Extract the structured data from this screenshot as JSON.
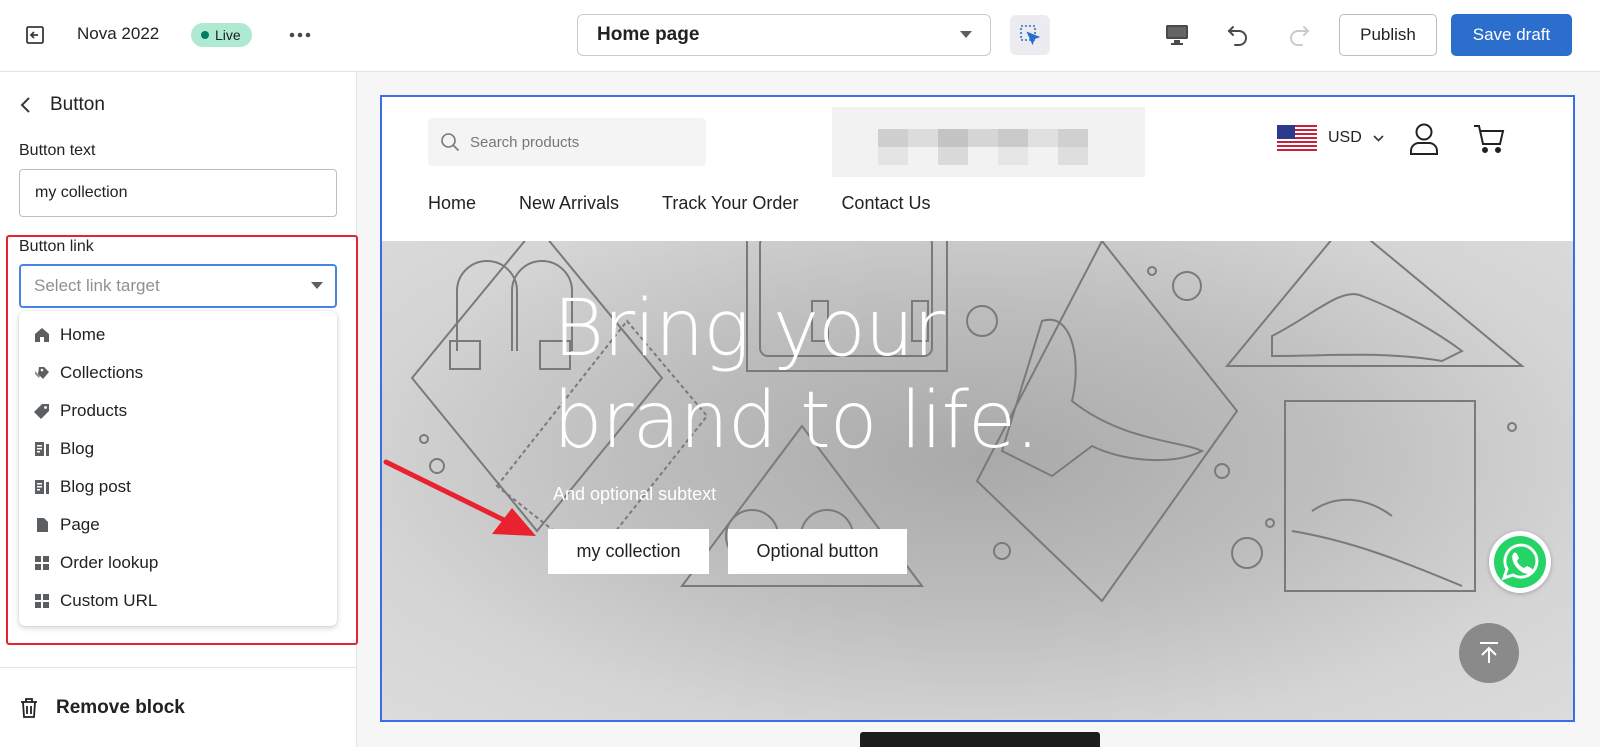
{
  "topbar": {
    "store_name": "Nova 2022",
    "status_badge": "Live",
    "page_selector": "Home page",
    "publish_label": "Publish",
    "save_label": "Save draft"
  },
  "sidebar": {
    "title": "Button",
    "button_text_label": "Button text",
    "button_text_value": "my collection",
    "button_link_label": "Button link",
    "link_placeholder": "Select link target",
    "link_options": [
      {
        "label": "Home",
        "icon": "home-icon"
      },
      {
        "label": "Collections",
        "icon": "collections-icon"
      },
      {
        "label": "Products",
        "icon": "tag-icon"
      },
      {
        "label": "Blog",
        "icon": "blog-icon"
      },
      {
        "label": "Blog post",
        "icon": "blog-post-icon"
      },
      {
        "label": "Page",
        "icon": "page-icon"
      },
      {
        "label": "Order lookup",
        "icon": "grid-icon"
      },
      {
        "label": "Custom URL",
        "icon": "grid-icon"
      }
    ],
    "remove_label": "Remove block"
  },
  "preview": {
    "search_placeholder": "Search products",
    "currency": "USD",
    "nav": [
      "Home",
      "New Arrivals",
      "Track Your Order",
      "Contact Us"
    ],
    "hero_title_line1": "Bring your",
    "hero_title_line2": "brand to life.",
    "hero_subtext": "And optional subtext",
    "primary_button": "my collection",
    "secondary_button": "Optional button"
  },
  "colors": {
    "accent": "#2c6ecb",
    "highlight": "#e8232f",
    "live_badge": "#aee9d1",
    "whatsapp": "#25d366"
  }
}
